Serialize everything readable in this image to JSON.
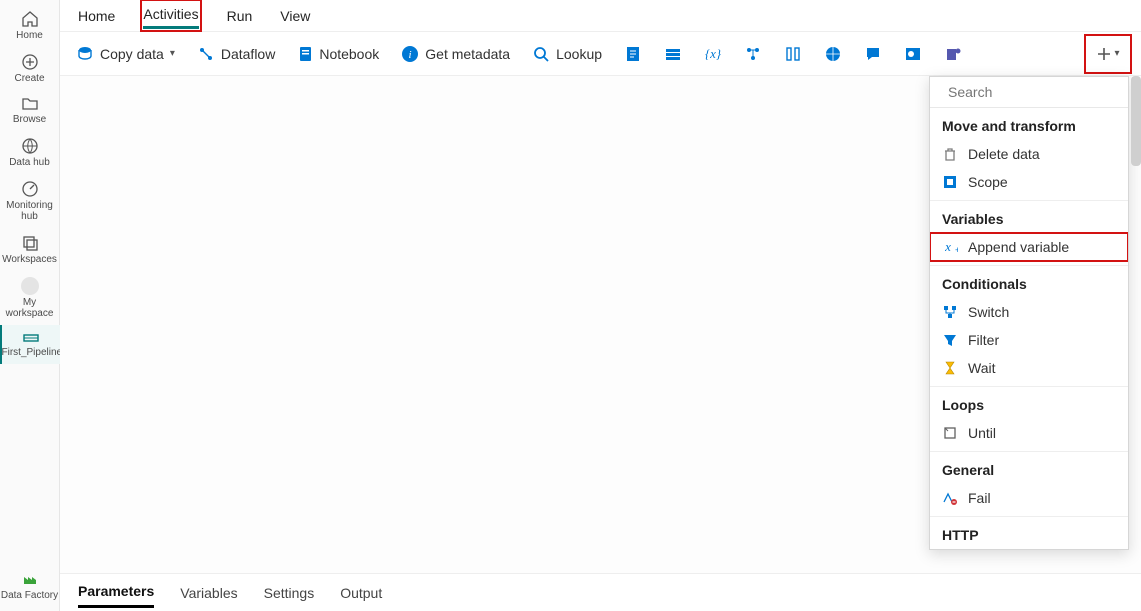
{
  "leftnav": {
    "items": [
      {
        "label": "Home",
        "icon": "home-icon"
      },
      {
        "label": "Create",
        "icon": "plus-circle-icon"
      },
      {
        "label": "Browse",
        "icon": "folder-icon"
      },
      {
        "label": "Data hub",
        "icon": "globe-data-icon"
      },
      {
        "label": "Monitoring hub",
        "icon": "monitor-icon"
      },
      {
        "label": "Workspaces",
        "icon": "workspaces-icon"
      },
      {
        "label": "My workspace",
        "icon": "dot-icon"
      },
      {
        "label": "First_Pipeline",
        "icon": "pipeline-icon",
        "selected": true
      }
    ],
    "footer": {
      "label": "Data Factory",
      "icon": "factory-icon"
    }
  },
  "tabs": [
    "Home",
    "Activities",
    "Run",
    "View"
  ],
  "active_tab": "Activities",
  "toolbar": {
    "copy_data": "Copy data",
    "dataflow": "Dataflow",
    "notebook": "Notebook",
    "get_metadata": "Get metadata",
    "lookup": "Lookup"
  },
  "toolbar_icons_only": [
    "script-icon",
    "list-icon",
    "variable-icon",
    "powerautomate-icon",
    "column-icon",
    "web-icon",
    "chat-icon",
    "outlook-icon",
    "teams-icon"
  ],
  "bottom_tabs": [
    "Parameters",
    "Variables",
    "Settings",
    "Output"
  ],
  "active_bottom_tab": "Parameters",
  "search": {
    "placeholder": "Search"
  },
  "popover": [
    {
      "group": "Move and transform",
      "items": [
        {
          "label": "Delete data",
          "icon": "trash-icon",
          "color": "#7d7d7d"
        },
        {
          "label": "Scope",
          "icon": "scope-icon",
          "color": "#0078d4"
        }
      ]
    },
    {
      "group": "Variables",
      "items": [
        {
          "label": "Append variable",
          "icon": "variable-plus-icon",
          "color": "#0078d4",
          "highlight": true
        }
      ]
    },
    {
      "group": "Conditionals",
      "items": [
        {
          "label": "Switch",
          "icon": "switch-icon",
          "color": "#0078d4"
        },
        {
          "label": "Filter",
          "icon": "filter-icon",
          "color": "#0078d4"
        },
        {
          "label": "Wait",
          "icon": "hourglass-icon",
          "color": "#fbbc05"
        }
      ]
    },
    {
      "group": "Loops",
      "items": [
        {
          "label": "Until",
          "icon": "until-icon",
          "color": "#616161"
        }
      ]
    },
    {
      "group": "General",
      "items": [
        {
          "label": "Fail",
          "icon": "fail-icon",
          "color": "#0078d4"
        }
      ]
    },
    {
      "group": "HTTP",
      "items": []
    }
  ]
}
